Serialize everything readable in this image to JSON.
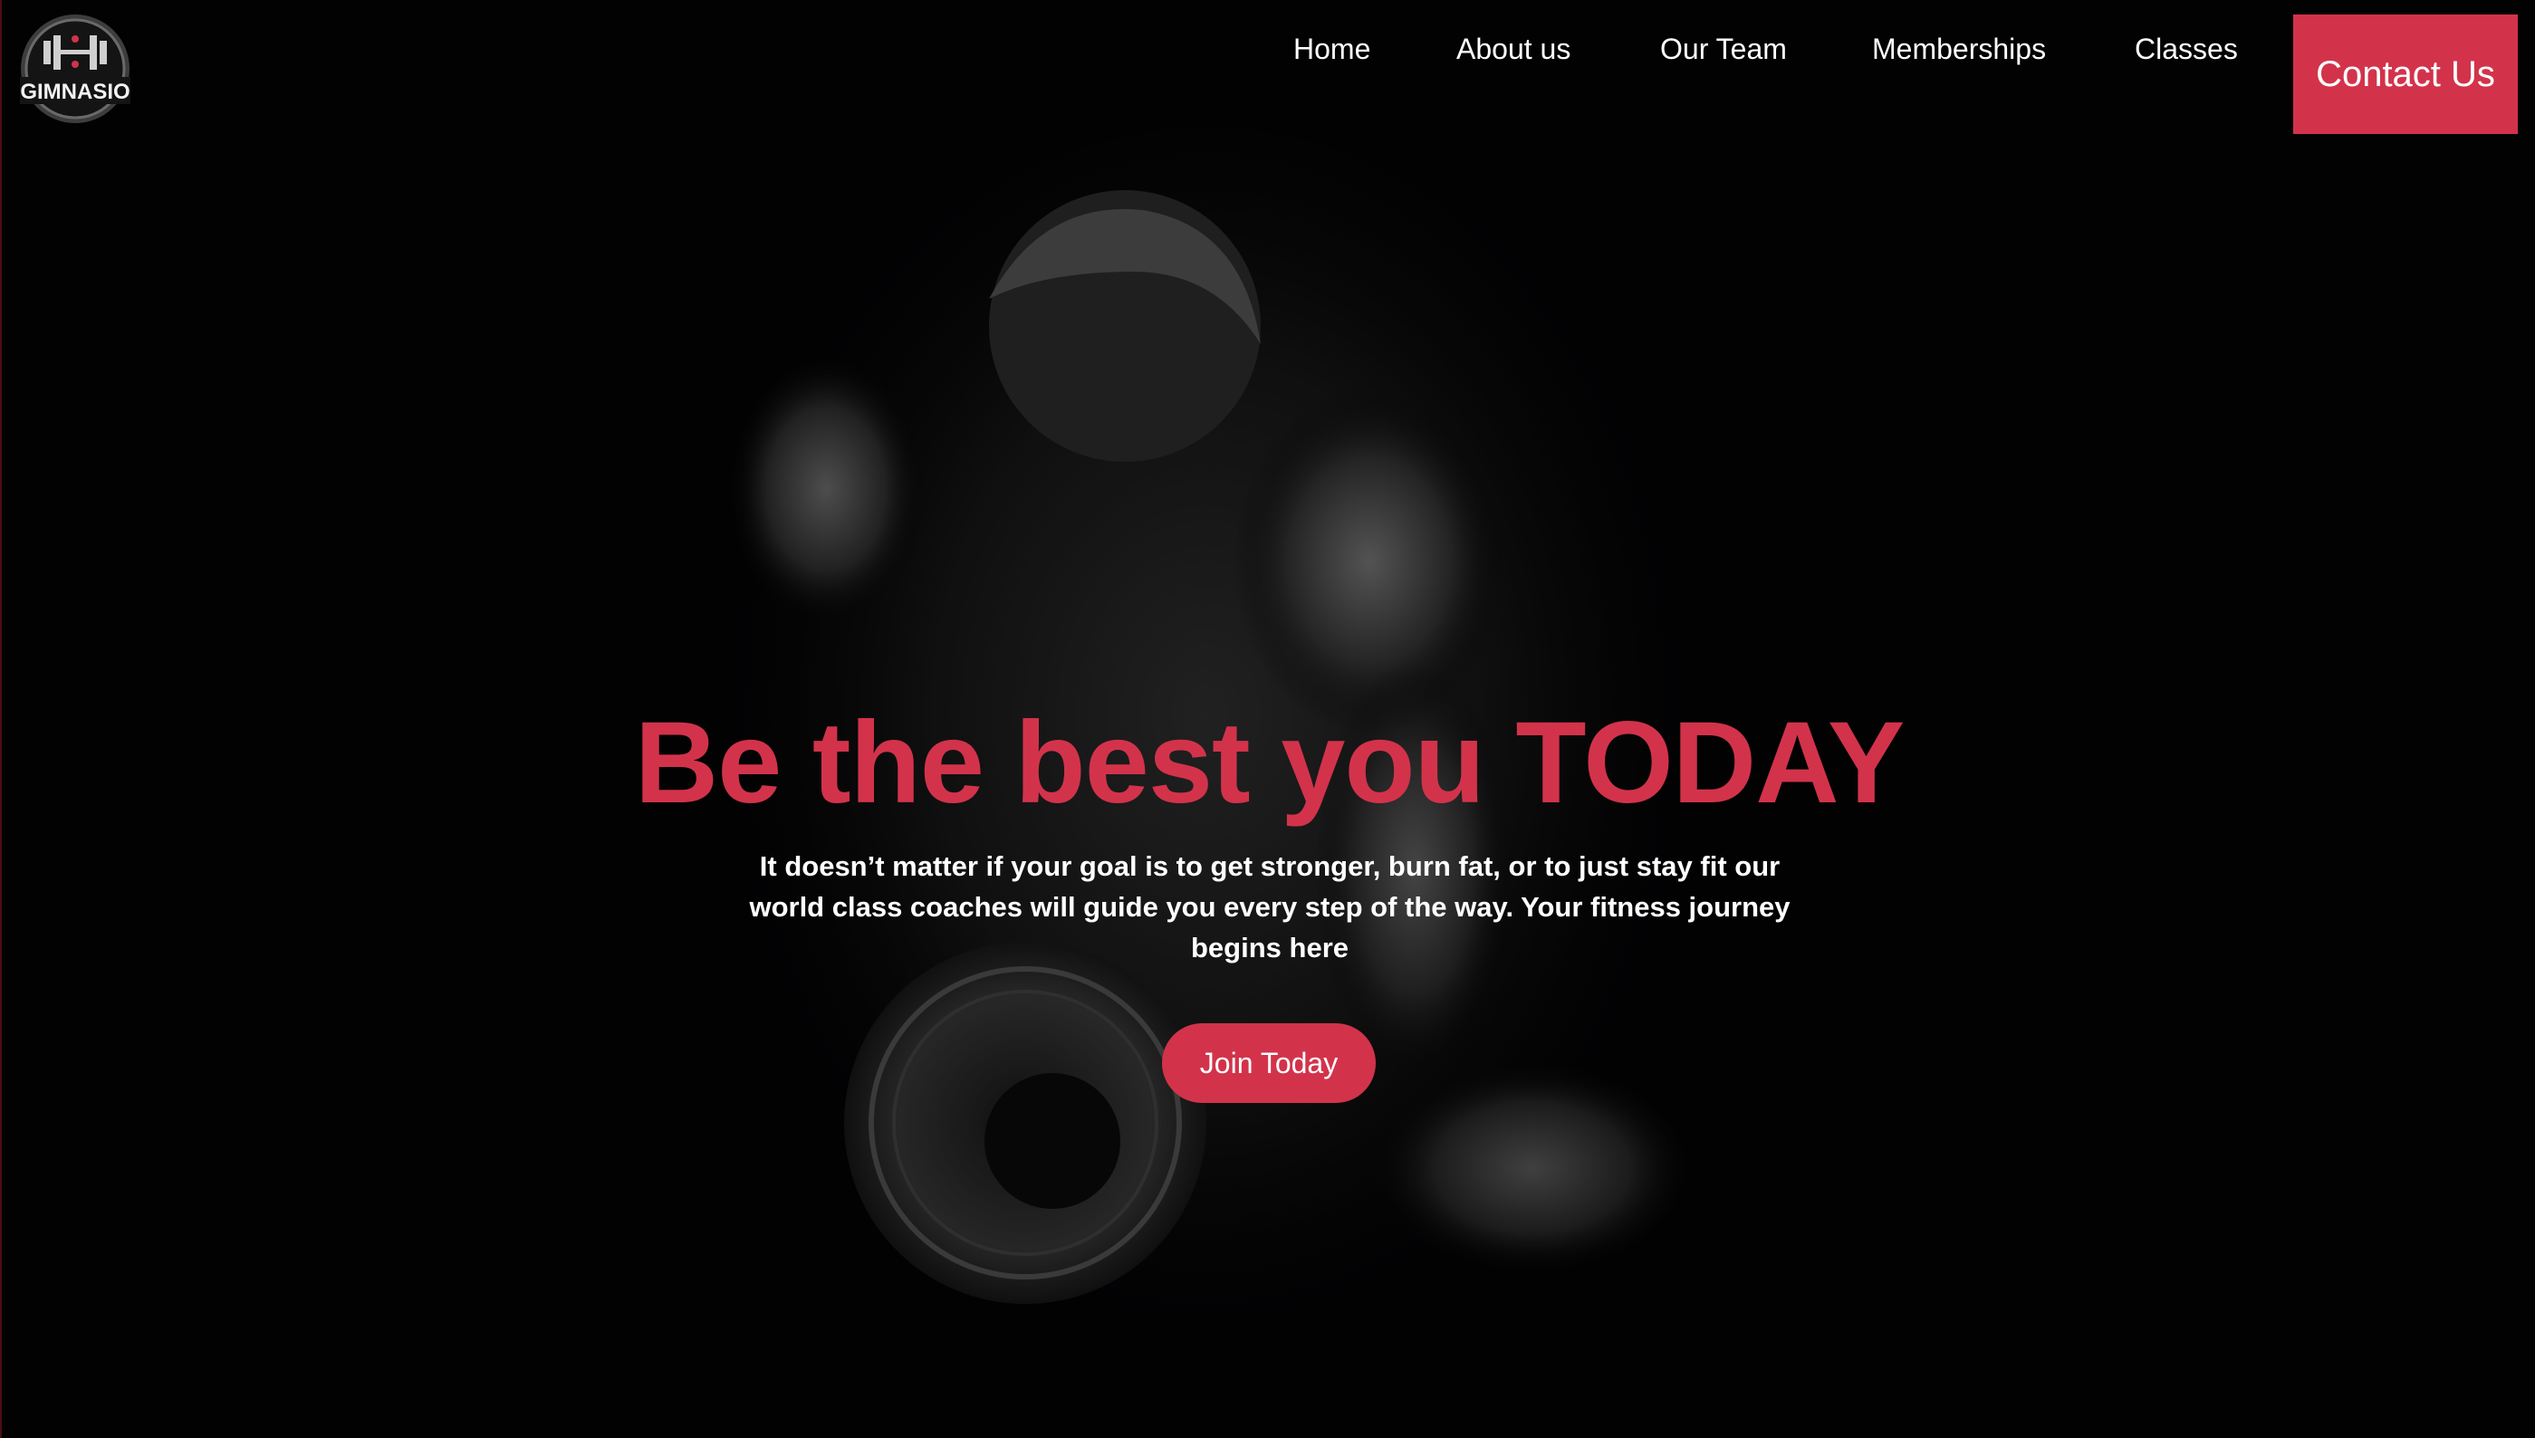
{
  "brand": {
    "logo_text": "GIMNASIO",
    "accent_color": "#d2334b",
    "background_color": "#020203"
  },
  "nav": {
    "items": [
      {
        "label": "Home"
      },
      {
        "label": "About us"
      },
      {
        "label": "Our Team"
      },
      {
        "label": "Memberships"
      },
      {
        "label": "Classes"
      }
    ],
    "contact_label": "Contact Us"
  },
  "hero": {
    "title": "Be the best you TODAY",
    "text": "It doesn’t matter if your goal is to get stronger, burn fat, or to just stay fit our world class coaches will guide you every step of the way. Your fitness journey begins here",
    "cta_label": "Join Today",
    "background_icon": "athlete-with-weight-plate-photo"
  }
}
